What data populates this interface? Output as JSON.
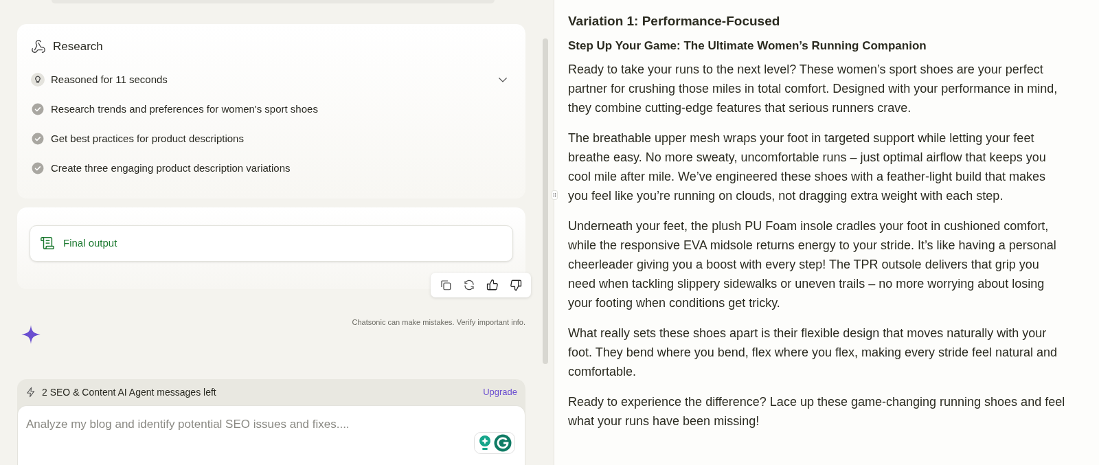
{
  "research": {
    "title": "Research",
    "items": [
      {
        "kind": "reasoning",
        "text": "Reasoned for 11 seconds",
        "expanded": false
      },
      {
        "kind": "step",
        "text": "Research trends and preferences for women's sport shoes"
      },
      {
        "kind": "step",
        "text": "Get best practices for product descriptions"
      },
      {
        "kind": "step",
        "text": "Create three engaging product description variations"
      }
    ]
  },
  "final_output": {
    "label": "Final output"
  },
  "disclaimer": "Chatsonic can make mistakes. Verify important info.",
  "composer": {
    "quota": "2 SEO & Content AI Agent messages left",
    "upgrade": "Upgrade",
    "placeholder": "Analyze my blog and identify potential SEO issues and fixes...."
  },
  "document": {
    "heading": "Variation 1: Performance-Focused",
    "subheading": "Step Up Your Game: The Ultimate Women’s Running Companion",
    "paragraphs": [
      "Ready to take your runs to the next level? These women’s sport shoes are your perfect partner for crushing those miles in total comfort. Designed with your performance in mind, they combine cutting-edge features that serious runners crave.",
      "The breathable upper mesh wraps your foot in targeted support while letting your feet breathe easy. No more sweaty, uncomfortable runs – just optimal airflow that keeps you cool mile after mile. We’ve engineered these shoes with a feather-light build that makes you feel like you’re running on clouds, not dragging extra weight with each step.",
      "Underneath your feet, the plush PU Foam insole cradles your foot in cushioned comfort, while the responsive EVA midsole returns energy to your stride. It’s like having a personal cheerleader giving you a boost with every step! The TPR outsole delivers that grip you need when tackling slippery sidewalks or uneven trails – no more worrying about losing your footing when conditions get tricky.",
      "What really sets these shoes apart is their flexible design that moves naturally with your foot. They bend where you bend, flex where you flex, making every stride feel natural and comfortable.",
      "Ready to experience the difference? Lace up these game-changing running shoes and feel what your runs have been missing!"
    ]
  }
}
